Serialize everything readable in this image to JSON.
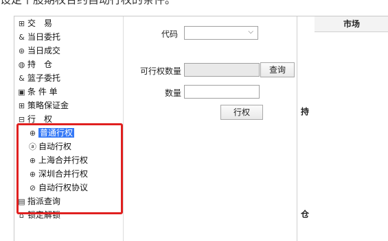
{
  "caption": "设定个股期权合约自动行权的条件。",
  "tree": {
    "items": [
      {
        "icon": "⊞",
        "label": "交　易"
      },
      {
        "icon": "&",
        "label": "当日委托"
      },
      {
        "icon": "⊛",
        "label": "当日成交"
      },
      {
        "icon": "◍",
        "label": "持　仓"
      },
      {
        "icon": "&",
        "label": "篮子委托"
      },
      {
        "icon": "▣",
        "label": "条 件 单"
      },
      {
        "icon": "⊞",
        "label": "策略保证金"
      },
      {
        "icon": "⊟",
        "label": "行　权"
      },
      {
        "icon": "⊕",
        "label": "普通行权"
      },
      {
        "icon": "ⓐ",
        "label": "自动行权"
      },
      {
        "icon": "⊕",
        "label": "上海合并行权"
      },
      {
        "icon": "⊕",
        "label": "深圳合并行权"
      },
      {
        "icon": "⊘",
        "label": "自动行权协议"
      },
      {
        "icon": "▤",
        "label": "指派查询"
      },
      {
        "icon": "⌂",
        "label": "锁定解锁"
      }
    ]
  },
  "form": {
    "code_label": "代码",
    "code_value": "",
    "exercisable_label": "可行权数量",
    "exercisable_value": "",
    "query_button": "查询",
    "quantity_label": "数量",
    "quantity_value": "",
    "exercise_button": "行权"
  },
  "side_panel": {
    "char_top": "持",
    "char_bottom": "仓"
  },
  "table": {
    "header": "市场"
  },
  "colors": {
    "highlight": "#e0201f",
    "selection": "#3478f6"
  }
}
